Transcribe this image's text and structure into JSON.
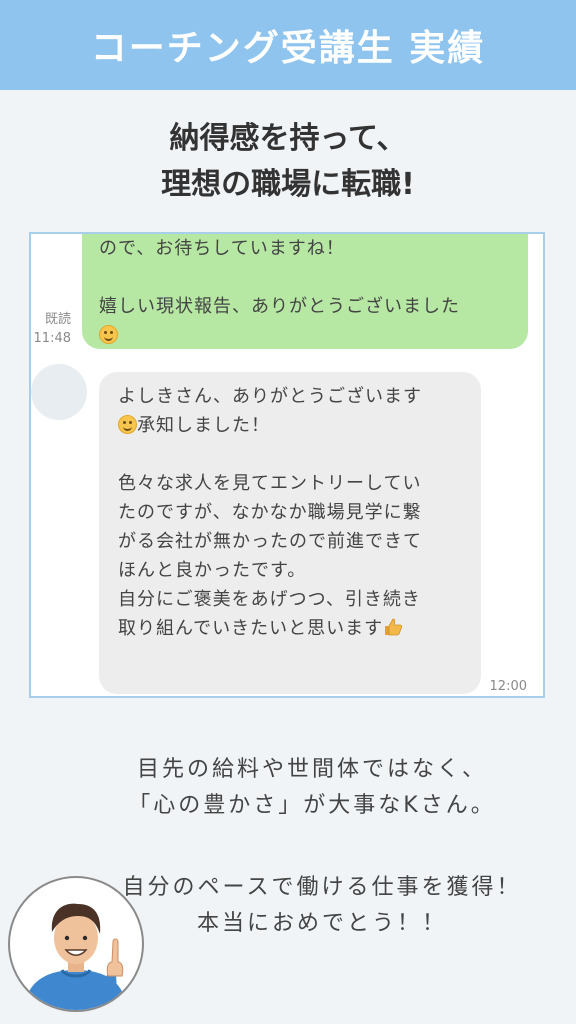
{
  "header": {
    "title": "コーチング受講生  実績"
  },
  "headline": {
    "line1": "納得感を持って、",
    "line2": "理想の職場に転職!"
  },
  "chat": {
    "sent": {
      "line1": "ので、お待ちしていますね！",
      "line2": "嬉しい現状報告、ありがとうございました",
      "emoji": "smile-emoji"
    },
    "read_label": "既読",
    "read_time": "11:48",
    "received": {
      "lines": [
        "よしきさん、ありがとうございます",
        "承知しました！",
        "",
        "色々な求人を見てエントリーしてい",
        "たのですが、なかなか職場見学に繋",
        "がる会社が無かったので前進できて",
        "ほんと良かったです。",
        "自分にご褒美をあげつつ、引き続き",
        "取り組んでいきたいと思います"
      ],
      "time": "12:00"
    }
  },
  "caption1": {
    "line1": "目先の給料や世間体ではなく、",
    "line2": "「心の豊かさ」が大事なKさん。"
  },
  "caption2": {
    "line1": "自分のペースで働ける仕事を獲得！",
    "line2": "本当におめでとう！！"
  },
  "colors": {
    "header_bg": "#8fc4ee",
    "sent_bubble": "#b6e8a4",
    "received_bubble": "#ededed",
    "chat_border": "#a7cfe9"
  }
}
